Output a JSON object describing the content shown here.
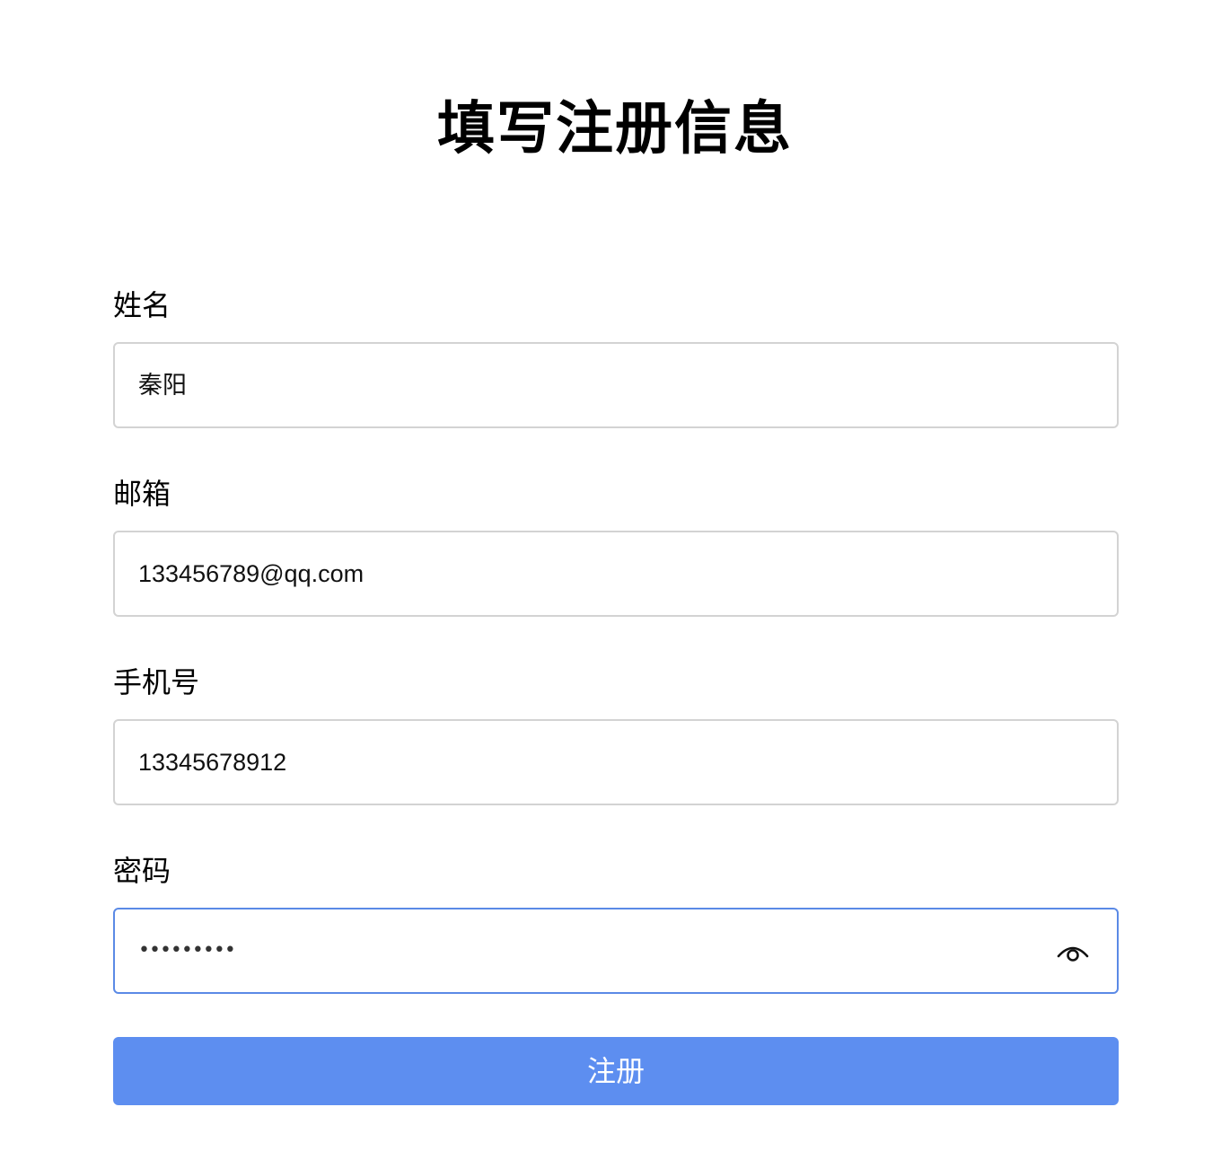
{
  "page": {
    "title": "填写注册信息"
  },
  "form": {
    "fields": [
      {
        "label": "姓名",
        "value": "秦阳"
      },
      {
        "label": "邮箱",
        "value": "133456789@qq.com"
      },
      {
        "label": "手机号",
        "value": "13345678912"
      },
      {
        "label": "密码",
        "value": "•••••••••"
      }
    ],
    "password_visibility_icon": "eye-icon",
    "submit_label": "注册"
  },
  "colors": {
    "accent": "#5d8ef0",
    "focus_border": "#5b8ae6",
    "input_border": "#d3d3d3"
  }
}
